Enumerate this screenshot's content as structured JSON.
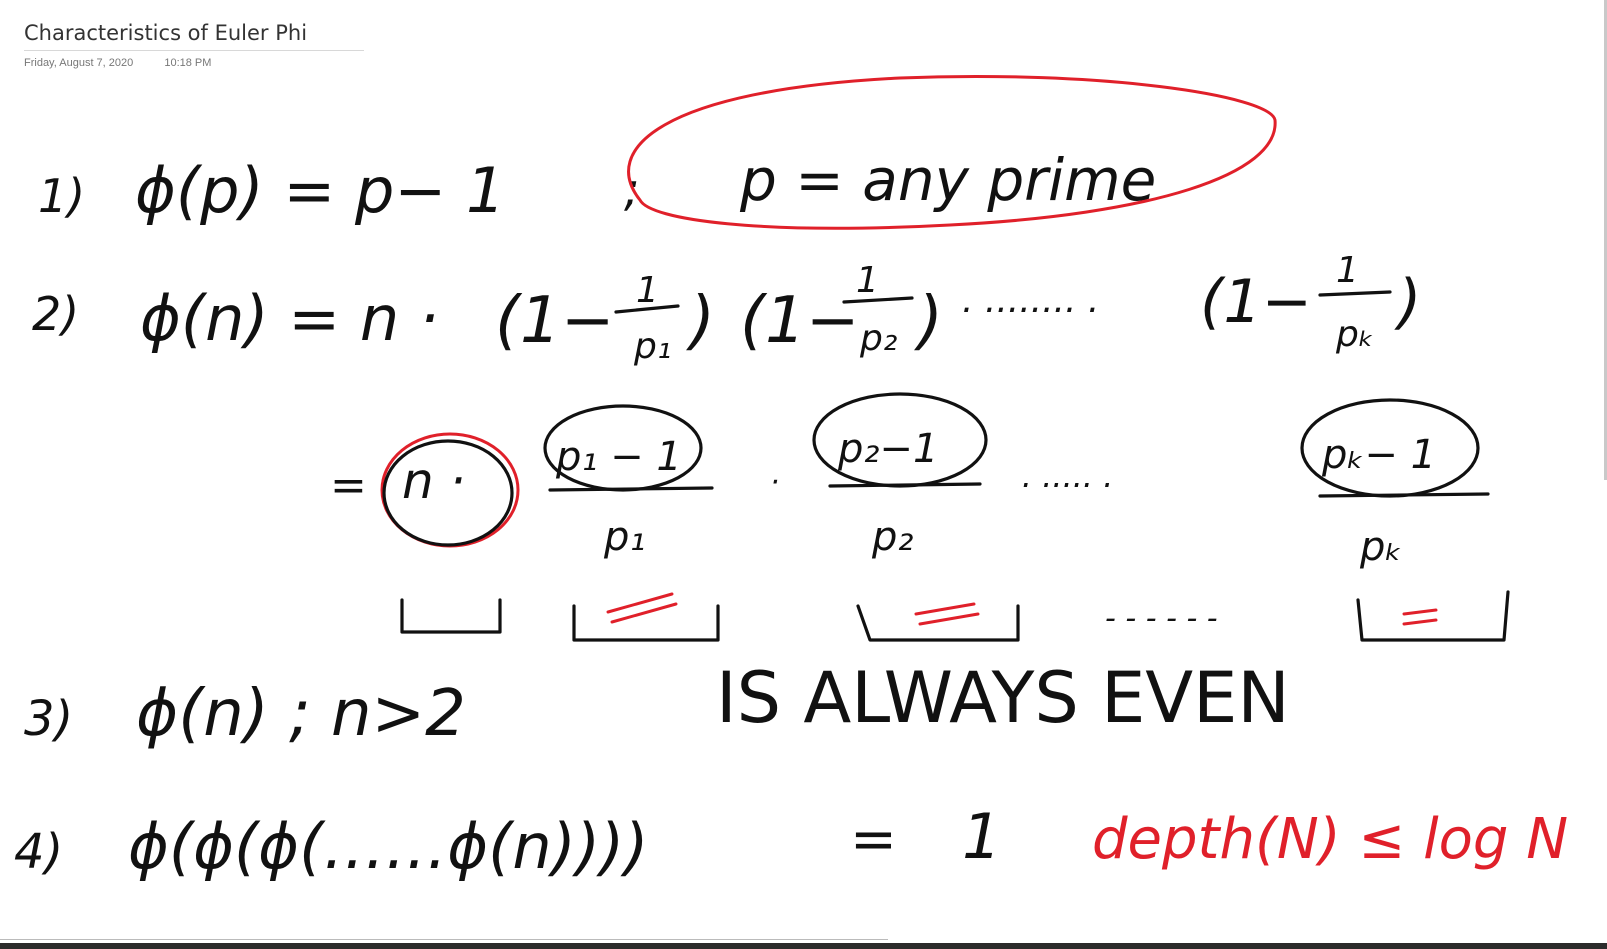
{
  "page": {
    "title": "Characteristics of Euler Phi",
    "date": "Friday, August 7, 2020",
    "time": "10:18 PM"
  },
  "ink": {
    "line1": {
      "num": "1)",
      "lhs": "ϕ(p) = p− 1",
      "sep": ";",
      "note": "p = any prime"
    },
    "line2": {
      "num": "2)",
      "lhs": "ϕ(n) = n ·",
      "f1": "(1−",
      "p1": "p₁",
      "f2": "(1−",
      "p2": "p₂",
      "dots": "· ········ ·",
      "f3": "(1−",
      "pk": "pₖ",
      "one": "1",
      "close": ")"
    },
    "line2b": {
      "eq": "=",
      "n": "n ·",
      "num1": "p₁ − 1",
      "den1": "p₁",
      "num2": "p₂−1",
      "den2": "p₂",
      "numk": "pₖ− 1",
      "denk": "pₖ",
      "dots": "· ····· ·",
      "dash": "- - - - - -"
    },
    "line3": {
      "num": "3)",
      "expr": "ϕ(n) ; n>2",
      "note": "IS ALWAYS EVEN"
    },
    "line4": {
      "num": "4)",
      "expr": "ϕ(ϕ(ϕ(……ϕ(n))))",
      "eq": "=",
      "one": "1",
      "note": "depth(N) ≤ log N"
    }
  },
  "colors": {
    "ink_dark": "#111111",
    "ink_red": "#e0202a"
  }
}
